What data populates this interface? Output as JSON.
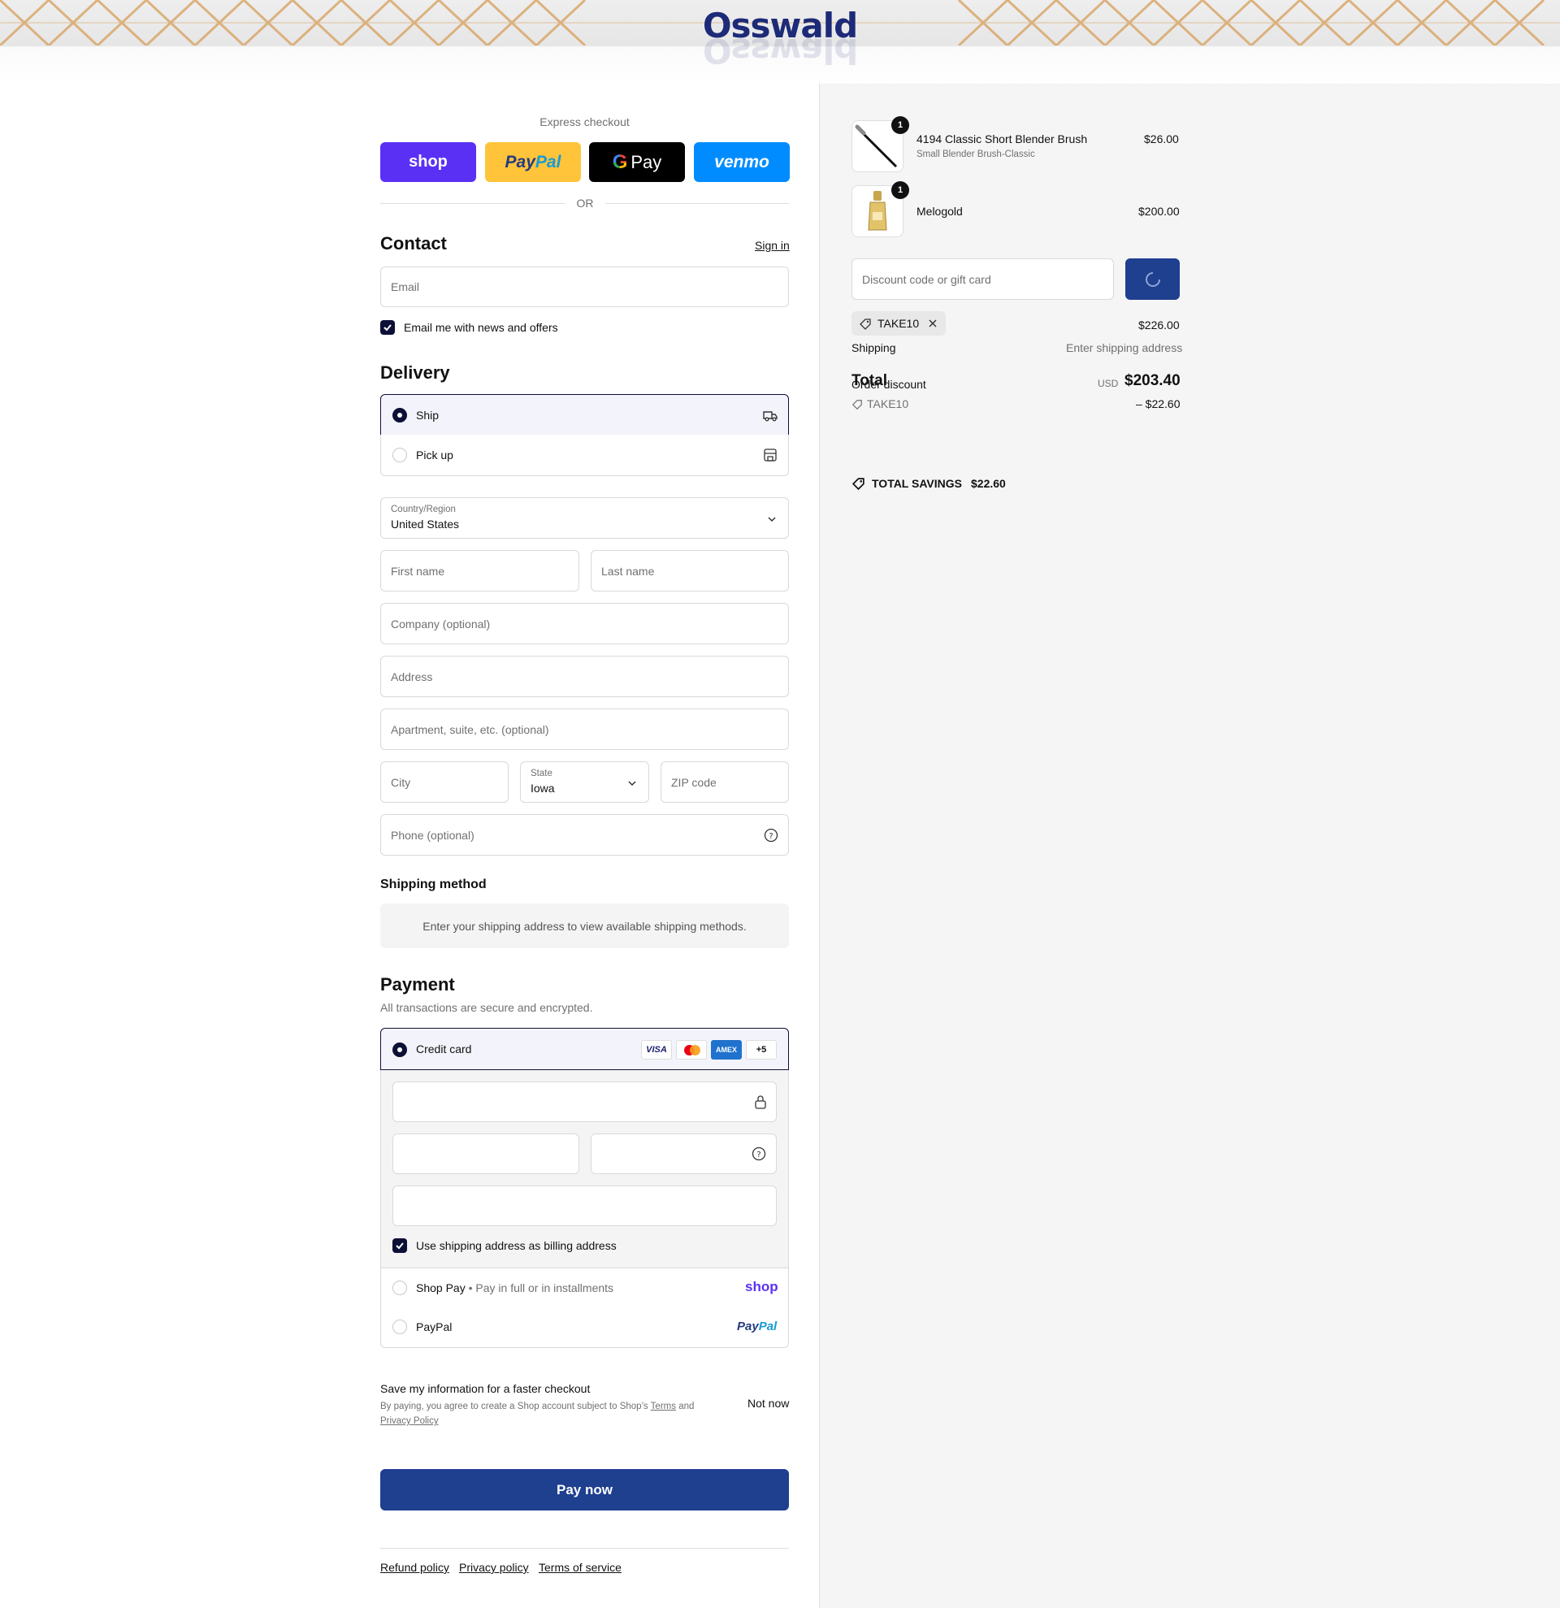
{
  "header": {
    "logo_alt": "Osswald"
  },
  "express": {
    "title": "Express checkout",
    "shop_label": "shop",
    "paypal_label": "PayPal",
    "gpay_label": "Pay",
    "venmo_label": "venmo",
    "or_label": "OR"
  },
  "contact": {
    "heading": "Contact",
    "sign_in": "Sign in",
    "email_placeholder": "Email",
    "news_label": "Email me with news and offers"
  },
  "delivery": {
    "heading": "Delivery",
    "ship_label": "Ship",
    "pickup_label": "Pick up",
    "country_label": "Country/Region",
    "country_value": "United States",
    "first_name": "First name",
    "last_name": "Last name",
    "company": "Company (optional)",
    "address": "Address",
    "apartment": "Apartment, suite, etc. (optional)",
    "city": "City",
    "state_label": "State",
    "state_value": "Iowa",
    "zip": "ZIP code",
    "phone": "Phone (optional)"
  },
  "shipping_method": {
    "heading": "Shipping method",
    "message": "Enter your shipping address to view available shipping methods."
  },
  "payment": {
    "heading": "Payment",
    "subtitle": "All transactions are secure and encrypted.",
    "credit_card_label": "Credit card",
    "card_brands": [
      "VISA",
      "Mastercard",
      "AMEX"
    ],
    "more_brands": "+5",
    "billing_label": "Use shipping address as billing address",
    "shop_pay_label": "Shop Pay",
    "shop_pay_sub": "Pay in full or in installments",
    "shop_logo": "shop",
    "paypal_label": "PayPal",
    "paypal_logo": "PayPal"
  },
  "save_info": {
    "title": "Save my information for a faster checkout",
    "disclaimer_1": "By paying, you agree to create a Shop account subject to Shop’s",
    "terms": "Terms",
    "and": "and",
    "privacy": "Privacy Policy",
    "not_now": "Not now"
  },
  "pay_now": "Pay now",
  "footer": {
    "links": [
      "Refund policy",
      "Privacy policy",
      "Terms of service"
    ]
  },
  "order": {
    "items": [
      {
        "name": "4194 Classic Short Blender Brush",
        "variant": "Small Blender Brush-Classic",
        "price": "$26.00",
        "qty": "1"
      },
      {
        "name": "Melogold",
        "variant": "",
        "price": "$200.00",
        "qty": "1"
      }
    ],
    "discount_placeholder": "Discount code or gift card",
    "applied_code": "TAKE10",
    "subtotal_value": "$226.00",
    "shipping_label": "Shipping",
    "shipping_value": "Enter shipping address",
    "order_discount_label": "Order discount",
    "total_label": "Total",
    "currency": "USD",
    "total_value": "$203.40",
    "discount_code": "TAKE10",
    "discount_value": "– $22.60",
    "savings_label": "TOTAL SAVINGS",
    "savings_value": "$22.60"
  },
  "colors": {
    "accent": "#1f3f8f",
    "radio_dark": "#0c0f36",
    "shop_purple": "#5a31f4",
    "paypal_yellow": "#ffc439",
    "venmo_blue": "#008cff"
  }
}
